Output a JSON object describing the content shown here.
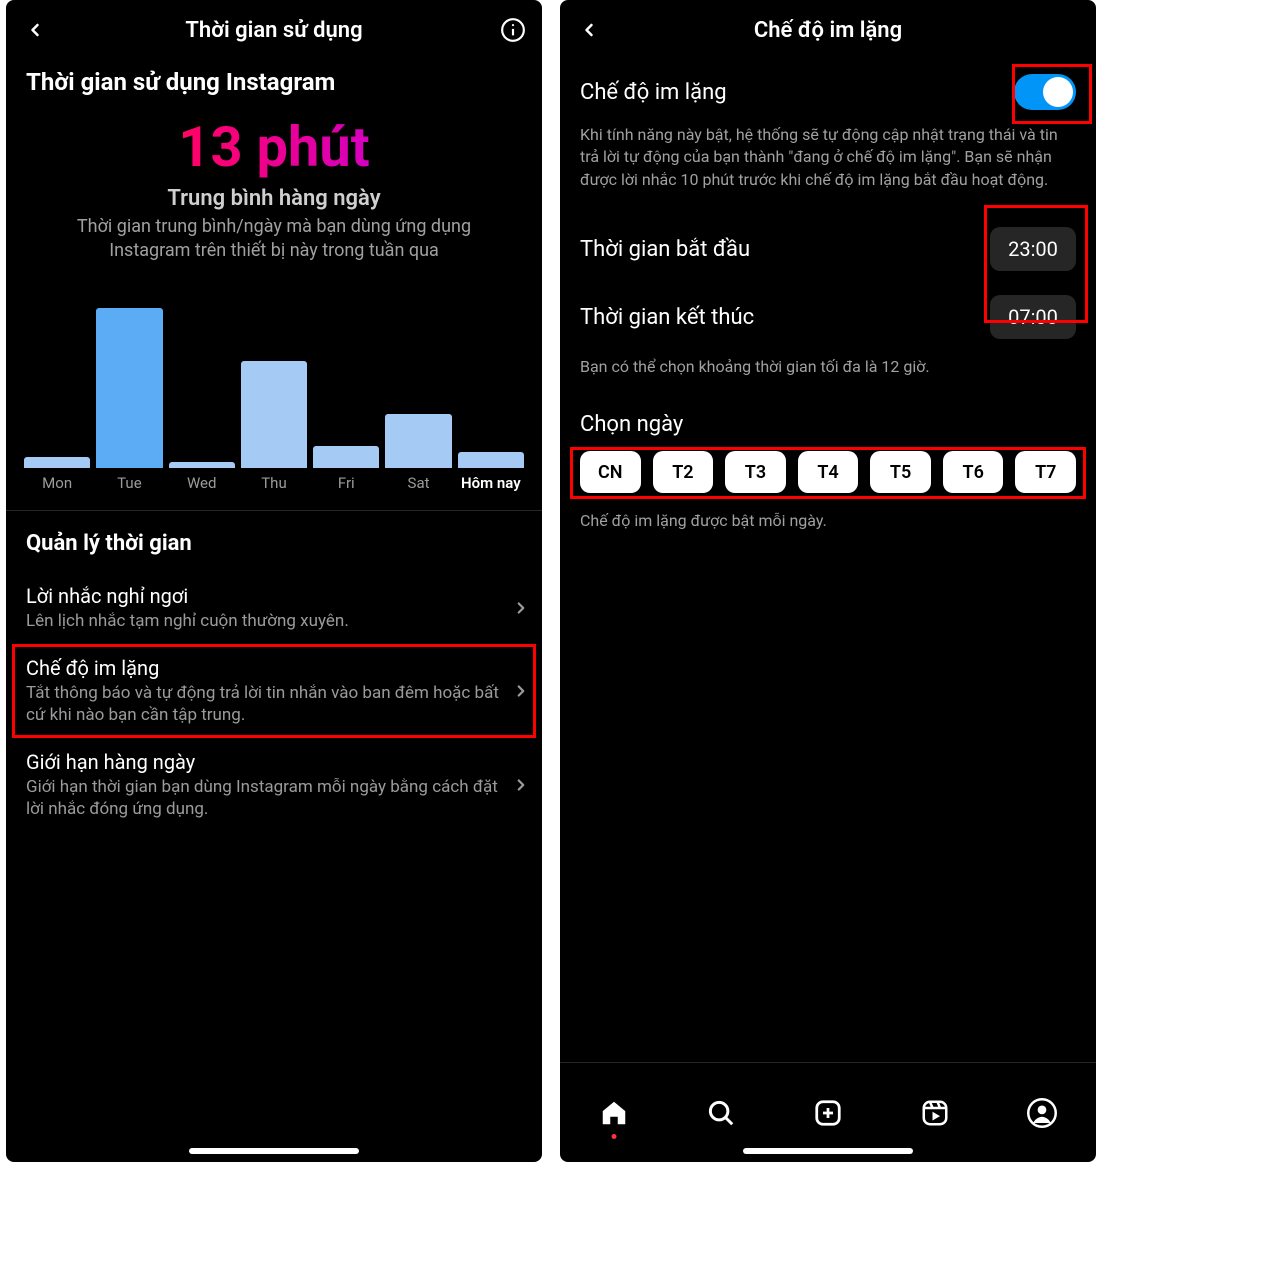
{
  "left": {
    "nav_title": "Thời gian sử dụng",
    "section_title": "Thời gian sử dụng Instagram",
    "big_number": "13 phút",
    "avg_label": "Trung bình hàng ngày",
    "avg_desc": "Thời gian trung bình/ngày mà bạn dùng ứng dụng Instagram trên thiết bị này trong tuần qua",
    "group_title": "Quản lý thời gian",
    "rows": [
      {
        "title": "Lời nhắc nghỉ ngơi",
        "sub": "Lên lịch nhắc tạm nghỉ cuộn thường xuyên."
      },
      {
        "title": "Chế độ im lặng",
        "sub": "Tắt thông báo và tự động trả lời tin nhắn vào ban đêm hoặc bất cứ khi nào bạn cần tập trung."
      },
      {
        "title": "Giới hạn hàng ngày",
        "sub": "Giới hạn thời gian bạn dùng Instagram mỗi ngày bằng cách đặt lời nhắc đóng ứng dụng."
      }
    ]
  },
  "right": {
    "nav_title": "Chế độ im lặng",
    "toggle_label": "Chế độ im lặng",
    "toggle_desc": "Khi tính năng này bật, hệ thống sẽ tự động cập nhật trạng thái và tin trả lời tự động của bạn thành \"đang ở chế độ im lặng\". Bạn sẽ nhận được lời nhắc 10 phút trước khi chế độ im lặng bắt đầu hoạt động.",
    "start_label": "Thời gian bắt đầu",
    "end_label": "Thời gian kết thúc",
    "start_time": "23:00",
    "end_time": "07:00",
    "time_note": "Bạn có thể chọn khoảng thời gian tối đa là 12 giờ.",
    "day_title": "Chọn ngày",
    "days": [
      "CN",
      "T2",
      "T3",
      "T4",
      "T5",
      "T6",
      "T7"
    ],
    "day_note": "Chế độ im lặng được bật mỗi ngày."
  },
  "chart_data": {
    "type": "bar",
    "categories": [
      "Mon",
      "Tue",
      "Wed",
      "Thu",
      "Fri",
      "Sat",
      "Hôm nay"
    ],
    "values": [
      2,
      30,
      1,
      20,
      4,
      10,
      3
    ],
    "active_index": 1,
    "today_index": 6,
    "title": "Thời gian sử dụng Instagram",
    "xlabel": "",
    "ylabel": "phút",
    "ylim": [
      0,
      30
    ]
  }
}
